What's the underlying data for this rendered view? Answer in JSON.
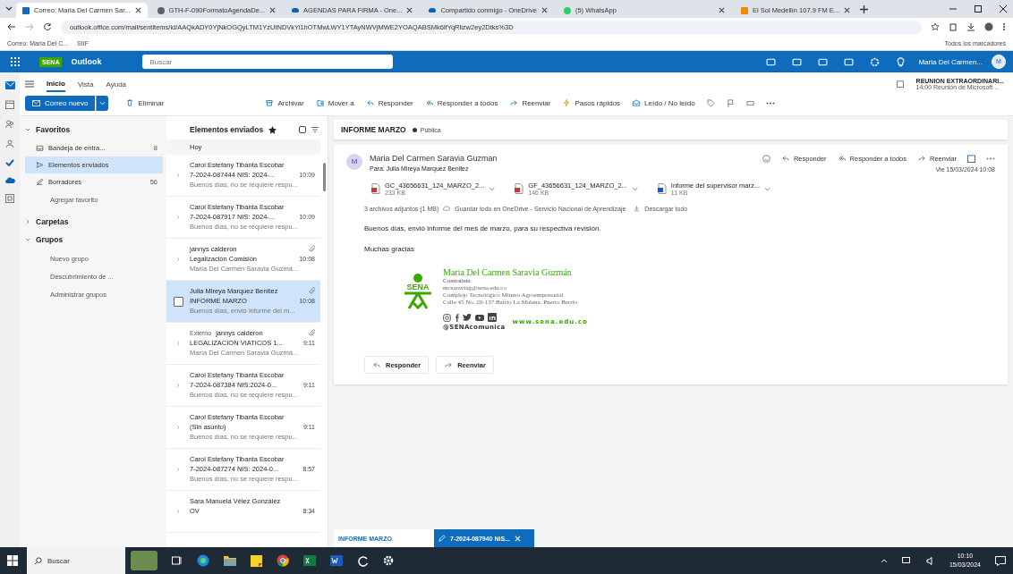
{
  "browser": {
    "tabs": [
      {
        "kind": "outlook",
        "label": "Correo: Maria Del Carmen Sar...",
        "selected": true
      },
      {
        "kind": "page",
        "label": "GTH-F-090FormatoAgendaDe...",
        "selected": false
      },
      {
        "kind": "onedrive",
        "label": "AGENDAS PARA FIRMA - One...",
        "selected": false
      },
      {
        "kind": "onedrive",
        "label": "Compartido conmigo - OneDrive",
        "selected": false
      },
      {
        "kind": "whatsapp",
        "label": "(5) WhatsApp",
        "selected": false
      },
      {
        "kind": "radio",
        "label": "El Sol Medellín 107.9 FM E...",
        "selected": false
      }
    ],
    "url": "outlook.office.com/mail/sentitems/id/AAQkADY0YjNkOGQyLTM1YzUtNDVkYi1hOTMwLWY1YTAyNWVjMWE2YOAQABSMk6lfYqRlizw2ey2Dtks%3D",
    "bookmarks": [
      "Correo: Maria Del C...",
      "SIIF"
    ],
    "all_bookmarks": "Todos los marcadores"
  },
  "header": {
    "app": "Outlook",
    "brand": "SENA",
    "search_placeholder": "Buscar",
    "user": "Maria Del Carmen...",
    "avatar": "M"
  },
  "ribbon": {
    "tabs": [
      {
        "label": "Inicio",
        "selected": true
      },
      {
        "label": "Vista",
        "selected": false
      },
      {
        "label": "Ayuda",
        "selected": false
      }
    ],
    "new_mail": "Correo nuevo",
    "commands": [
      {
        "kind": "delete",
        "label": "Eliminar"
      },
      {
        "kind": "archive",
        "label": "Archivar"
      },
      {
        "kind": "move",
        "label": "Mover a"
      },
      {
        "kind": "reply",
        "label": "Responder"
      },
      {
        "kind": "reply_all",
        "label": "Responder a todos"
      },
      {
        "kind": "forward",
        "label": "Reenviar"
      },
      {
        "kind": "quick",
        "label": "Pasos rápidos"
      },
      {
        "kind": "read",
        "label": "Leído / No leído"
      }
    ],
    "reminder": {
      "title": "REUNION EXTRAORDINARI...",
      "detail": "14:00 Reunión de Microsoft ..."
    }
  },
  "folders": {
    "sections": [
      {
        "title": "Favoritos",
        "expanded": true,
        "items": [
          {
            "kind": "inbox",
            "label": "Bandeja de entra...",
            "count": "8",
            "selected": false
          },
          {
            "kind": "sent",
            "label": "Elementos enviados",
            "selected": true
          },
          {
            "kind": "drafts",
            "label": "Borradores",
            "count": "56",
            "selected": false
          },
          {
            "kind": "link",
            "label": "Agregar favorito",
            "selected": false
          }
        ]
      },
      {
        "title": "Carpetas",
        "expanded": false
      },
      {
        "title": "Grupos",
        "expanded": true,
        "items": [
          {
            "kind": "link",
            "label": "Nuevo grupo",
            "selected": false
          },
          {
            "kind": "link",
            "label": "Descubrimiento de ...",
            "selected": false
          },
          {
            "kind": "link",
            "label": "Administrar grupos",
            "selected": false
          }
        ]
      }
    ]
  },
  "list": {
    "title": "Elementos enviados",
    "group": "Hoy",
    "messages": [
      {
        "sender": "Carol Estefany Tibanta Escobar",
        "subject": "7-2024-087444 NIS: 2024-...",
        "time": "10:09",
        "preview": "Buenos días, no se requiere respu...",
        "attachment": false,
        "selected": false
      },
      {
        "sender": "Carol Estefany Tibanta Escobar",
        "subject": "7-2024-087917 NIS: 2024-...",
        "time": "10:09",
        "preview": "Buenos días, no se requiere respu...",
        "attachment": false,
        "selected": false
      },
      {
        "sender": "jannys calderon",
        "subject": "Legalización Comisión",
        "time": "10:08",
        "preview": "María Del Carmen Saravia Guzmá...",
        "attachment": true,
        "selected": false
      },
      {
        "sender": "Julia Mireya Marquez Benitez",
        "subject": "INFORME MARZO",
        "time": "10:08",
        "preview": "Buenos días, envió informe del m...",
        "attachment": true,
        "selected": true
      },
      {
        "tag": "Externo",
        "sender": "jannys calderon",
        "subject": "LEGALIZACION VIATICOS 1...",
        "time": "9:11",
        "preview": "María Del Carmen Saravia Guzmá...",
        "attachment": true,
        "selected": false
      },
      {
        "sender": "Carol Estefany Tibanta Escobar",
        "subject": "7-2024-087384 NIS:2024-0...",
        "time": "9:11",
        "preview": "Buenos días, no se requiere respu...",
        "attachment": false,
        "selected": false
      },
      {
        "sender": "Carol Estefany Tibanta Escobar",
        "subject": "(Sin asunto)",
        "time": "9:11",
        "preview": "Buenos días, no se requiere respu...",
        "attachment": false,
        "selected": false
      },
      {
        "sender": "Carol Estefany Tibanta Escobar",
        "subject": "7-2024-087274 NIS: 2024-0...",
        "time": "8:57",
        "preview": "Buenos días, no se requiere respu...",
        "attachment": false,
        "selected": false
      },
      {
        "sender": "Sara Manuela Vélez González",
        "subject": "OV",
        "time": "8:34",
        "attachment": false,
        "selected": false
      }
    ]
  },
  "reading": {
    "subject": "INFORME MARZO",
    "label": "Pública",
    "sender": "Maria Del Carmen Saravia Guzman",
    "avatar": "M",
    "to_label": "Para:",
    "to": "Julia Mireya Marquez Benitez",
    "actions": [
      {
        "kind": "reply",
        "label": "Responder"
      },
      {
        "kind": "reply_all",
        "label": "Responder a todos"
      },
      {
        "kind": "forward",
        "label": "Reenviar"
      }
    ],
    "date": "Vie 15/03/2024 10:08",
    "attachments": [
      {
        "kind": "pdf",
        "name": "GC_43656631_124_MARZO_2...",
        "size": "233 KB"
      },
      {
        "kind": "pdf",
        "name": "GF_43656631_124_MARZO_2...",
        "size": "146 KB"
      },
      {
        "kind": "word",
        "name": "Informe del supervisor marz...",
        "size": "11 KB"
      }
    ],
    "attachments_summary": "3 archivos adjuntos (1 MB)",
    "save_all": "Guardar todo en OneDrive - Servicio Nacional de Aprendizaje",
    "download_all": "Descargar todo",
    "body": [
      "Buenos días, envió informe del mes de marzo, para su respectiva revisión.",
      "Muchas gracias"
    ],
    "signature": {
      "logo": "SENA",
      "name": "Maria Del Carmen Saravia Guzmán",
      "role": "Contratista",
      "email": "mcsaraviag@sena.edu.co",
      "org": "Complejo Tecnológico Minero Agroempresarial",
      "address": "Calle 45 No. 20-137 Barrio La Malena. Puerto Berrío",
      "handle": "@SENAcomunica",
      "website": "www.sena.edu.co"
    },
    "footer_buttons": [
      {
        "kind": "reply",
        "label": "Responder"
      },
      {
        "kind": "forward",
        "label": "Reenviar"
      }
    ],
    "draft_tabs": [
      {
        "label": "INFORME MARZO",
        "selected": false
      },
      {
        "label": "7-2024-087940 NIS...",
        "selected": true
      }
    ]
  },
  "taskbar": {
    "search_placeholder": "Buscar",
    "time": "10:10",
    "date": "15/03/2024"
  }
}
